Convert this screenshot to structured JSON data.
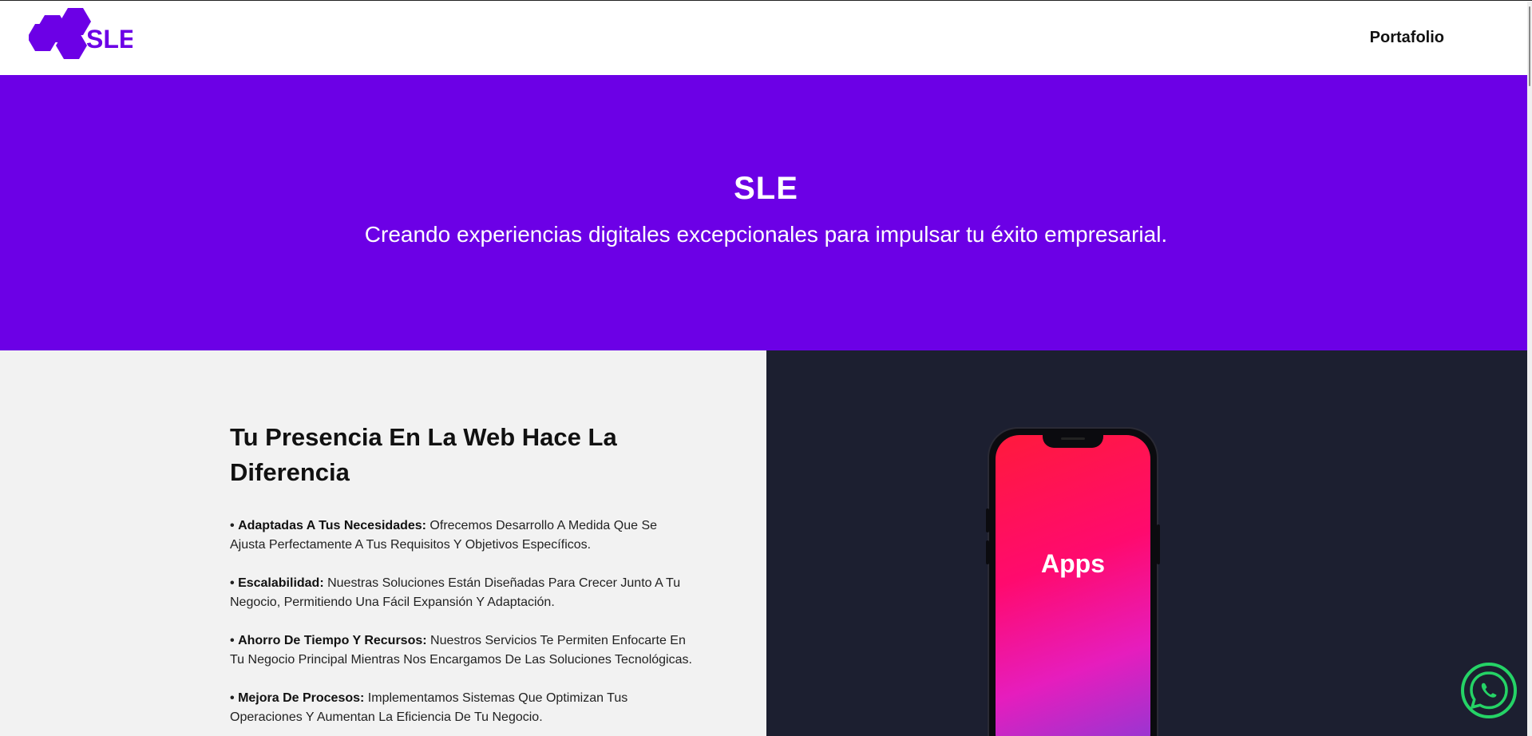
{
  "header": {
    "logo_text": "SLE",
    "nav": {
      "portfolio_label": "Portafolio"
    }
  },
  "hero": {
    "title": "SLE",
    "subtitle": "Creando experiencias digitales excepcionales para impulsar tu éxito empresarial."
  },
  "main": {
    "section_title": "Tu Presencia En La Web Hace La Diferencia",
    "features": [
      {
        "bullet": "•",
        "title": "Adaptadas A Tus Necesidades:",
        "text": " Ofrecemos Desarrollo A Medida Que Se Ajusta Perfectamente A Tus Requisitos Y Objetivos Específicos."
      },
      {
        "bullet": "•",
        "title": "Escalabilidad:",
        "text": " Nuestras Soluciones Están Diseñadas Para Crecer Junto A Tu Negocio, Permitiendo Una Fácil Expansión Y Adaptación."
      },
      {
        "bullet": "•",
        "title": "Ahorro De Tiempo Y Recursos:",
        "text": " Nuestros Servicios Te Permiten Enfocarte En Tu Negocio Principal Mientras Nos Encargamos De Las Soluciones Tecnológicas."
      },
      {
        "bullet": "•",
        "title": "Mejora De Procesos:",
        "text": " Implementamos Sistemas Que Optimizan Tus Operaciones Y Aumentan La Eficiencia De Tu Negocio."
      }
    ],
    "phone_label": "Apps"
  },
  "colors": {
    "accent": "#6c00e6",
    "dark_panel": "#1c1f30",
    "light_panel": "#f2f2f2",
    "whatsapp": "#25d366"
  },
  "icons": {
    "logo": "hexagon-logo-icon",
    "whatsapp": "whatsapp-icon"
  }
}
